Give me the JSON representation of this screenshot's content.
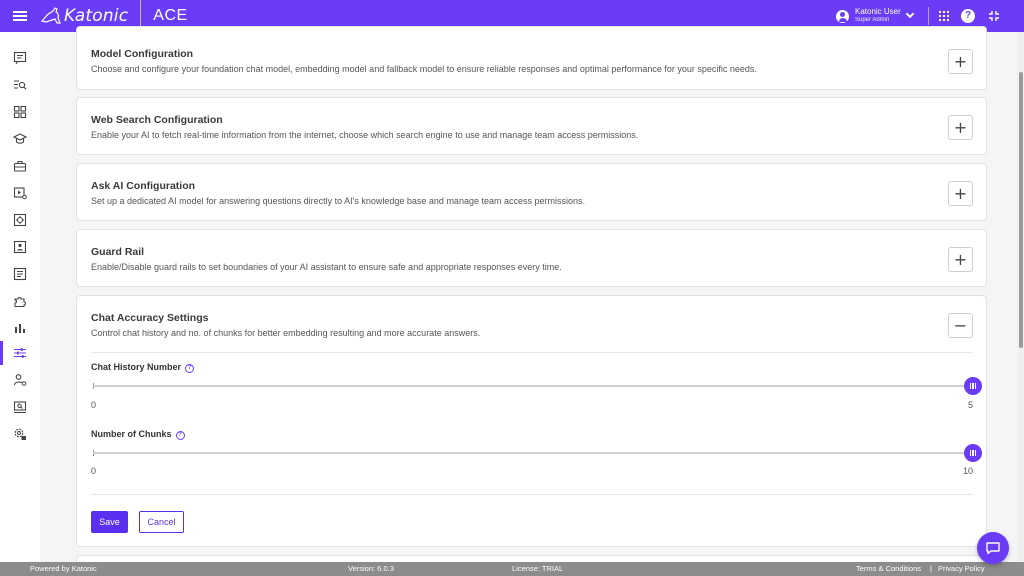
{
  "header": {
    "logo_text": "Katonic",
    "app_name": "ACE",
    "user_name": "Katonic User",
    "user_role": "Super Admin",
    "help_glyph": "?"
  },
  "sidebar": {
    "items": [
      {
        "icon": "chat-icon"
      },
      {
        "icon": "search-list-icon"
      },
      {
        "icon": "grid-icon"
      },
      {
        "icon": "graduation-cap-icon"
      },
      {
        "icon": "toolbox-icon"
      },
      {
        "icon": "video-settings-icon"
      },
      {
        "icon": "target-icon"
      },
      {
        "icon": "contact-card-icon"
      },
      {
        "icon": "document-list-icon"
      },
      {
        "icon": "puzzle-icon"
      },
      {
        "icon": "bar-chart-icon"
      },
      {
        "icon": "sliders-icon",
        "active": true
      },
      {
        "icon": "user-settings-icon"
      },
      {
        "icon": "monitor-search-icon"
      },
      {
        "icon": "gear-lock-icon"
      }
    ]
  },
  "sections": {
    "model": {
      "title": "Model Configuration",
      "description": "Choose and configure your foundation chat model, embedding model and fallback model to ensure reliable responses and optimal performance for your specific needs.",
      "toggle": "+"
    },
    "web_search": {
      "title": "Web Search Configuration",
      "description": "Enable your AI to fetch real-time information from the internet, choose which search engine to use and manage team access permissions.",
      "toggle": "+"
    },
    "ask_ai": {
      "title": "Ask AI Configuration",
      "description": "Set up a dedicated AI model for answering questions directly to AI's knowledge base and manage team access permissions.",
      "toggle": "+"
    },
    "guard_rail": {
      "title": "Guard Rail",
      "description": "Enable/Disable guard rails to set boundaries of your AI assistant to ensure safe and appropriate responses every time.",
      "toggle": "+"
    },
    "chat_accuracy": {
      "title": "Chat Accuracy Settings",
      "description": "Control chat history and no. of chunks for better embedding resulting and more accurate answers.",
      "toggle": "−",
      "history": {
        "label": "Chat History Number",
        "min": "0",
        "max": "5",
        "value": "5",
        "fill": 1.0
      },
      "chunks": {
        "label": "Number of Chunks",
        "min": "0",
        "max": "10",
        "value": "10",
        "fill": 1.0
      },
      "save_label": "Save",
      "cancel_label": "Cancel"
    }
  },
  "footer": {
    "powered_by": "Powered by Katonic",
    "version": "Version: 6.0.3",
    "license": "License: TRIAL",
    "terms": "Terms & Conditions",
    "separator": "|",
    "privacy": "Privacy Policy"
  },
  "colors": {
    "brand": "#6a3cf5",
    "button": "#5a2ff0",
    "footer": "#8c8c8c"
  }
}
